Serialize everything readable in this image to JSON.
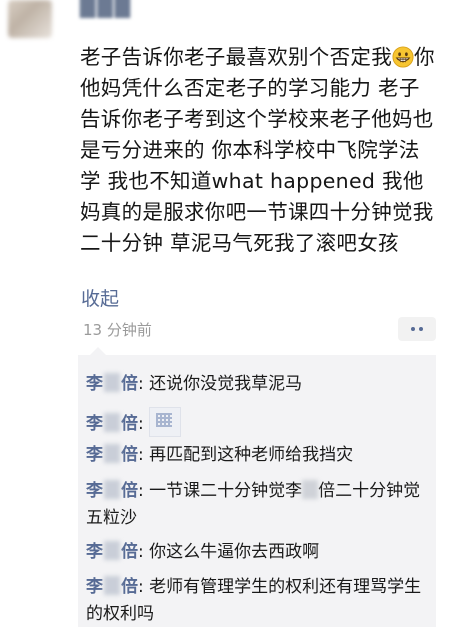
{
  "post": {
    "text_segments": {
      "before_emoji": "老子告诉你老子最喜欢别个否定我",
      "after_emoji": "你他妈凭什么否定老子的学习能力 老子告诉你老子考到这个学校来老子他妈也是亏分进来的 你本科学校中飞院学法学 我也不知道what happened 我他妈真的是服求你吧一节课四十分钟觉我二十分钟 草泥马气死我了滚吧女孩"
    },
    "emoji": "grinning-face-icon",
    "collapse_label": "收起",
    "timestamp": "13 分钟前"
  },
  "comments": [
    {
      "name_start": "李",
      "name_end": "倍",
      "sep": ": ",
      "text": "还说你没觉我草泥马"
    },
    {
      "name_start": "李",
      "name_end": "倍",
      "sep": ": ",
      "text": "",
      "attachment": "qr-code-image"
    },
    {
      "name_start": "李",
      "name_end": "倍",
      "sep": ": ",
      "text": "再匹配到这种老师给我挡灾"
    },
    {
      "name_start": "李",
      "name_end": "倍",
      "sep": ": ",
      "text_a": "一节课二十分钟觉李",
      "text_b": "倍二十分钟觉五粒沙"
    },
    {
      "name_start": "李",
      "name_end": "倍",
      "sep": ": ",
      "text": "你这么牛逼你去西政啊"
    },
    {
      "name_start": "李",
      "name_end": "倍",
      "sep": ": ",
      "text": "老师有管理学生的权利还有理骂学生的权利吗"
    }
  ],
  "colors": {
    "link": "#576b95",
    "text": "#1a1a1a",
    "muted": "#9b9b9b",
    "comment_bg": "#f3f3f5"
  }
}
